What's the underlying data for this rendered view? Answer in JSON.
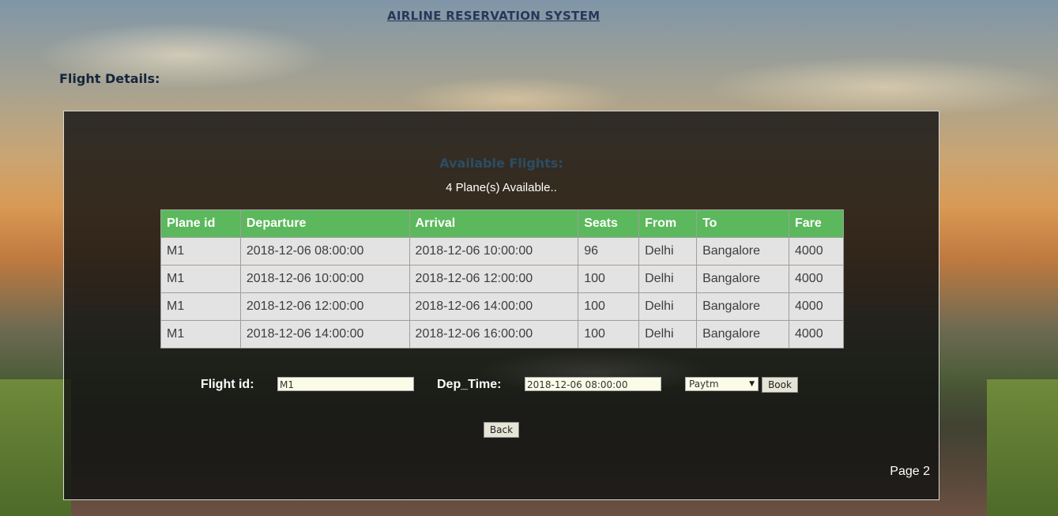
{
  "header": {
    "title": "AIRLINE RESERVATION SYSTEM"
  },
  "section": {
    "heading": "Flight Details:"
  },
  "results": {
    "heading": "Available Flights:",
    "count_text": "4 Plane(s) Available..",
    "columns": [
      "Plane id",
      "Departure",
      "Arrival",
      "Seats",
      "From",
      "To",
      "Fare"
    ],
    "rows": [
      [
        "M1",
        "2018-12-06 08:00:00",
        "2018-12-06 10:00:00",
        "96",
        "Delhi",
        "Bangalore",
        "4000"
      ],
      [
        "M1",
        "2018-12-06 10:00:00",
        "2018-12-06 12:00:00",
        "100",
        "Delhi",
        "Bangalore",
        "4000"
      ],
      [
        "M1",
        "2018-12-06 12:00:00",
        "2018-12-06 14:00:00",
        "100",
        "Delhi",
        "Bangalore",
        "4000"
      ],
      [
        "M1",
        "2018-12-06 14:00:00",
        "2018-12-06 16:00:00",
        "100",
        "Delhi",
        "Bangalore",
        "4000"
      ]
    ]
  },
  "booking_form": {
    "flight_id_label": "Flight id:",
    "flight_id_value": "M1",
    "dep_time_label": "Dep_Time:",
    "dep_time_value": "2018-12-06 08:00:00",
    "payment_selected": "Paytm",
    "book_label": "Book",
    "back_label": "Back"
  },
  "footer": {
    "page_label": "Page 2"
  },
  "colors": {
    "table_header": "#5cb85c",
    "title": "#25385a",
    "panel_bg": "#121212"
  }
}
